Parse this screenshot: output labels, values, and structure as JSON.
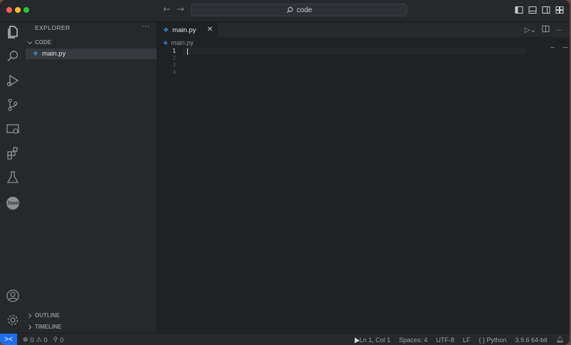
{
  "window": {
    "search_label": "code",
    "traffic_lights": [
      "#ff5f57",
      "#febc2e",
      "#28c840"
    ]
  },
  "activity_bar": {
    "items": [
      {
        "icon": "files-icon"
      },
      {
        "icon": "search-icon"
      },
      {
        "icon": "run-debug-icon"
      },
      {
        "icon": "source-control-icon"
      },
      {
        "icon": "remote-explorer-icon"
      },
      {
        "icon": "extensions-icon"
      },
      {
        "icon": "testing-icon"
      },
      {
        "icon": "json-icon",
        "label": "Json"
      }
    ],
    "bottom": [
      {
        "icon": "account-icon"
      },
      {
        "icon": "manage-gear-icon"
      }
    ]
  },
  "sidebar": {
    "title": "EXPLORER",
    "more": "···",
    "folder": "CODE",
    "files": [
      {
        "name": "main.py",
        "icon": "python-file-icon"
      }
    ],
    "outline": "OUTLINE",
    "timeline": "TIMELINE"
  },
  "editor": {
    "tab_label": "main.py",
    "breadcrumb": "main.py",
    "line_numbers": [
      "1",
      "2",
      "3",
      "4"
    ],
    "active_line": "1",
    "more": "···"
  },
  "statusbar": {
    "errors": "0",
    "warnings": "0",
    "ports": "0",
    "position": "Ln 1, Col 1",
    "spaces": "Spaces: 4",
    "encoding": "UTF-8",
    "eol": "LF",
    "language": "Python",
    "interpreter": "3.9.6 64-bit"
  },
  "colors": {
    "accent": "#1f6feb",
    "python_icon": "#3b8bd5",
    "background": "#1f2124",
    "panels": "#26282c"
  }
}
